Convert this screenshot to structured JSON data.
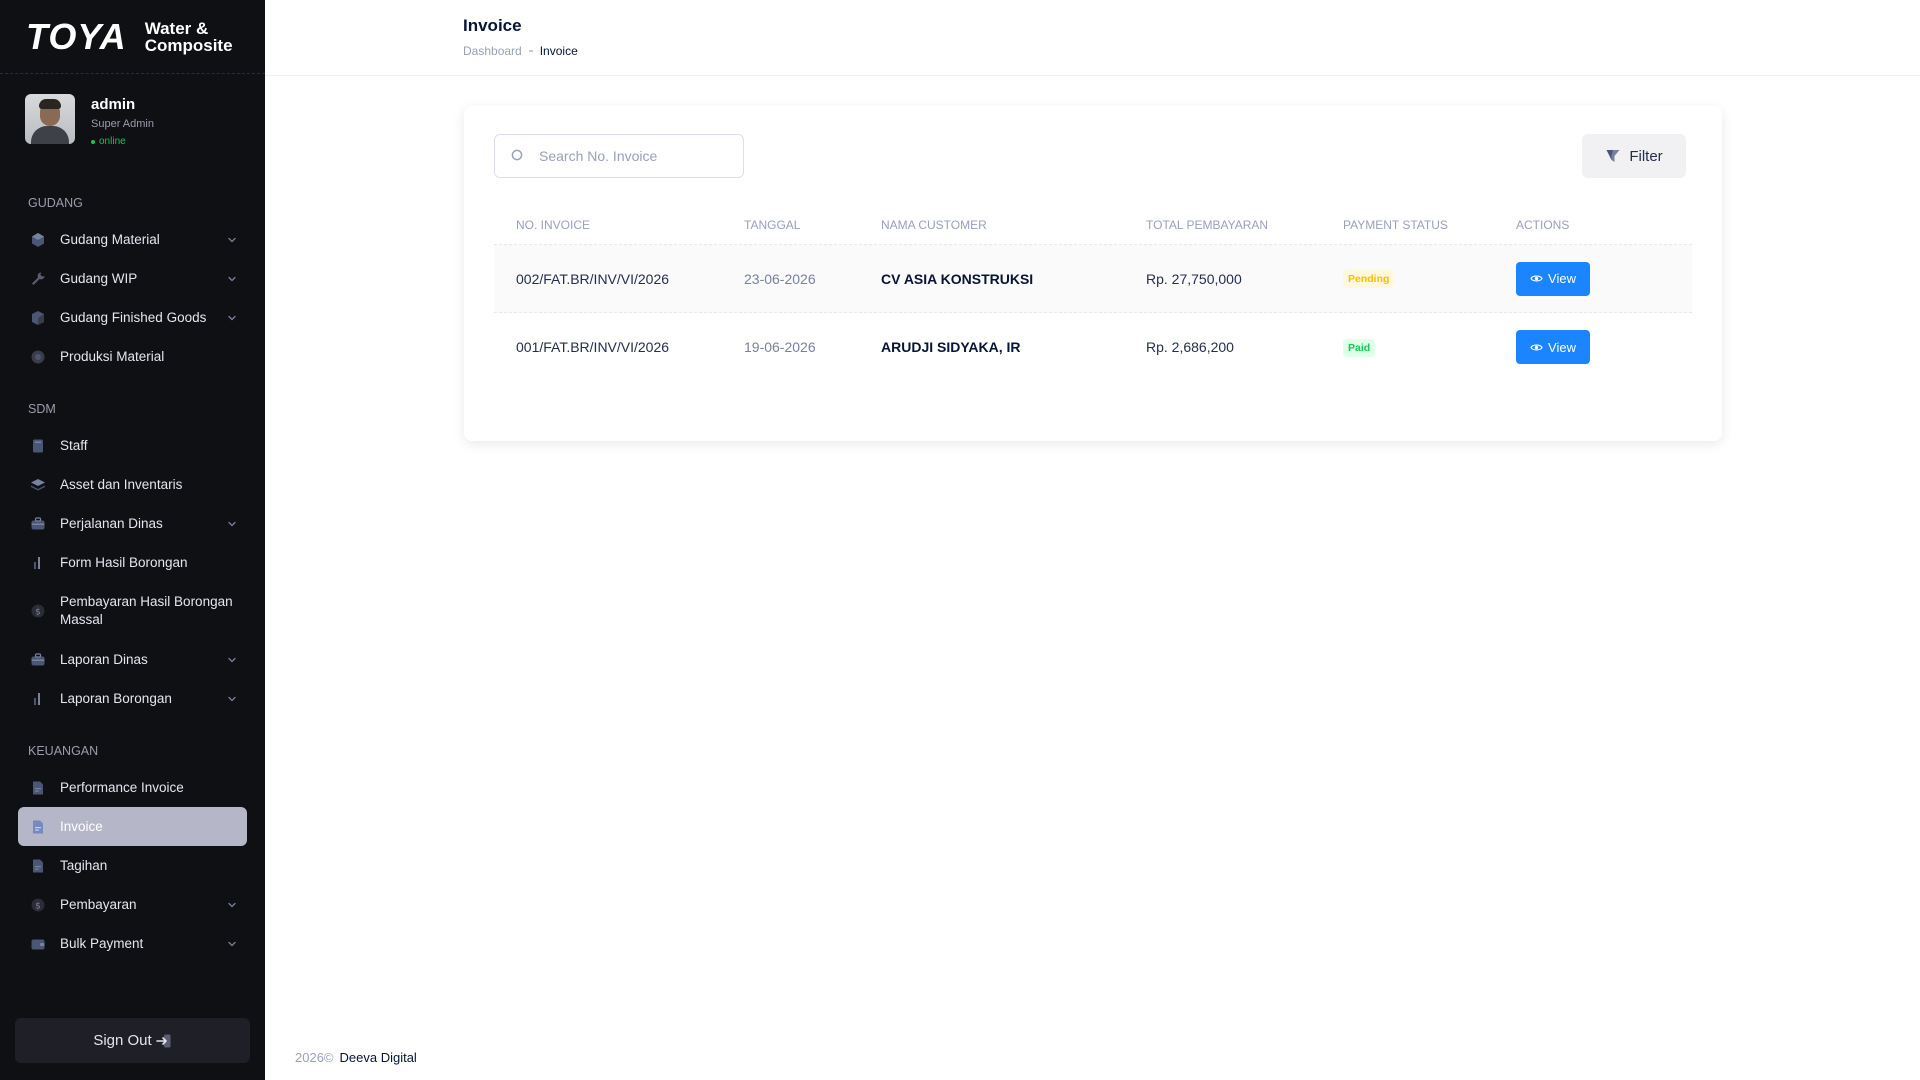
{
  "sidebar": {
    "logo": {
      "brand": "TOYA",
      "line1": "Water &",
      "line2": "Composite"
    },
    "profile": {
      "name": "admin",
      "role": "Super Admin",
      "status": "online"
    },
    "sections": [
      {
        "title": "GUDANG",
        "items": [
          {
            "label": "Gudang Material",
            "icon": "cube-icon",
            "expandable": true
          },
          {
            "label": "Gudang WIP",
            "icon": "wrench-icon",
            "expandable": true
          },
          {
            "label": "Gudang Finished Goods",
            "icon": "box-icon",
            "expandable": true
          },
          {
            "label": "Produksi Material",
            "icon": "disc-icon",
            "expandable": false
          }
        ]
      },
      {
        "title": "SDM",
        "items": [
          {
            "label": "Staff",
            "icon": "book-icon",
            "expandable": false
          },
          {
            "label": "Asset dan Inventaris",
            "icon": "layers-icon",
            "expandable": false
          },
          {
            "label": "Perjalanan Dinas",
            "icon": "briefcase-icon",
            "expandable": true
          },
          {
            "label": "Form Hasil Borongan",
            "icon": "bar-chart-icon",
            "expandable": false
          },
          {
            "label": "Pembayaran Hasil Borongan Massal",
            "icon": "dollar-icon",
            "expandable": false
          },
          {
            "label": "Laporan Dinas",
            "icon": "briefcase-icon",
            "expandable": true
          },
          {
            "label": "Laporan Borongan",
            "icon": "bar-chart-icon",
            "expandable": true
          }
        ]
      },
      {
        "title": "KEUANGAN",
        "items": [
          {
            "label": "Performance Invoice",
            "icon": "document-icon",
            "expandable": false
          },
          {
            "label": "Invoice",
            "icon": "document-icon",
            "expandable": false,
            "active": true
          },
          {
            "label": "Tagihan",
            "icon": "document-icon",
            "expandable": false
          },
          {
            "label": "Pembayaran",
            "icon": "dollar-icon",
            "expandable": true
          },
          {
            "label": "Bulk Payment",
            "icon": "wallet-icon",
            "expandable": true
          }
        ]
      }
    ],
    "signout_label": "Sign Out"
  },
  "header": {
    "title": "Invoice",
    "breadcrumb": {
      "home": "Dashboard",
      "current": "Invoice"
    }
  },
  "toolbar": {
    "search_placeholder": "Search No. Invoice",
    "filter_label": "Filter"
  },
  "table": {
    "columns": [
      "NO. INVOICE",
      "TANGGAL",
      "NAMA CUSTOMER",
      "TOTAL PEMBAYARAN",
      "PAYMENT STATUS",
      "ACTIONS"
    ],
    "rows": [
      {
        "no_invoice": "002/FAT.BR/INV/VI/2026",
        "tanggal": "23-06-2026",
        "customer": "CV ASIA KONSTRUKSI",
        "total": "Rp. 27,750,000",
        "status": "Pending",
        "action": "View"
      },
      {
        "no_invoice": "001/FAT.BR/INV/VI/2026",
        "tanggal": "19-06-2026",
        "customer": "ARUDJI SIDYAKA, IR",
        "total": "Rp. 2,686,200",
        "status": "Paid",
        "action": "View"
      }
    ]
  },
  "footer": {
    "year": "2026©",
    "brand": "Deeva Digital"
  },
  "colors": {
    "sidebar_bg": "#0f1014",
    "active_item_bg": "#b5b7c8",
    "primary": "#1b84ff",
    "pending_text": "#f6c000",
    "pending_bg": "#fff8dd",
    "paid_text": "#17c653",
    "paid_bg": "#dfffea"
  }
}
